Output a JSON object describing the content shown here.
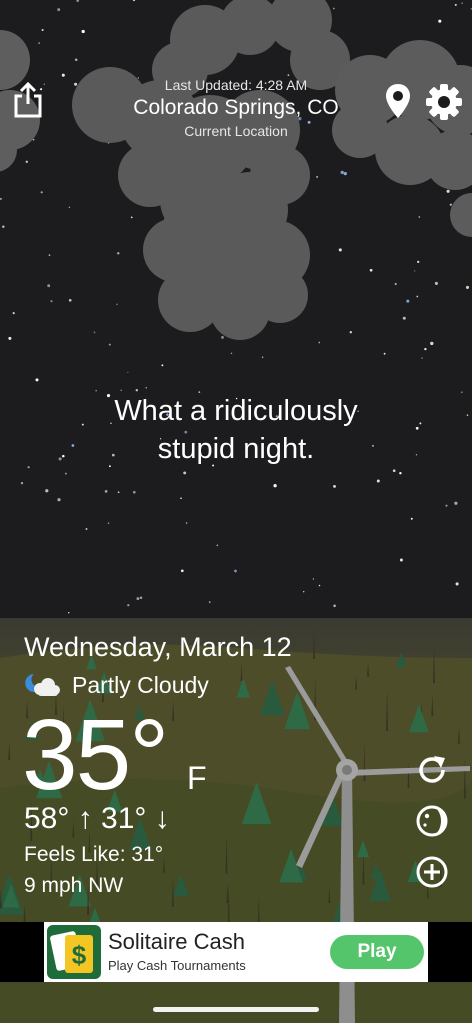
{
  "header": {
    "last_updated": "Last Updated: 4:28 AM",
    "city": "Colorado Springs, CO",
    "current_location": "Current Location"
  },
  "quip": {
    "line1": "What a ridiculously",
    "line2": "stupid night."
  },
  "weather": {
    "date": "Wednesday, March 12",
    "condition": "Partly Cloudy",
    "condition_icon": "partly-cloudy-night-icon",
    "temperature": "35°",
    "unit": "F",
    "high_low": "58° ↑ 31° ↓",
    "feels_like": "Feels Like: 31°",
    "wind": "9 mph NW"
  },
  "ad": {
    "title": "Solitaire Cash",
    "subtitle": "Play Cash Tournaments",
    "button": "Play",
    "button_color": "#55c56b"
  },
  "icons": {
    "share": "share-icon",
    "location": "location-pin-icon",
    "settings": "gear-icon",
    "refresh": "refresh-icon",
    "moon": "moon-phase-icon",
    "add": "add-circle-icon"
  },
  "colors": {
    "sky": "#1c1c1e",
    "cloud": "#606060",
    "ground": "#4a4a2a",
    "accent_text": "#ffffff"
  }
}
